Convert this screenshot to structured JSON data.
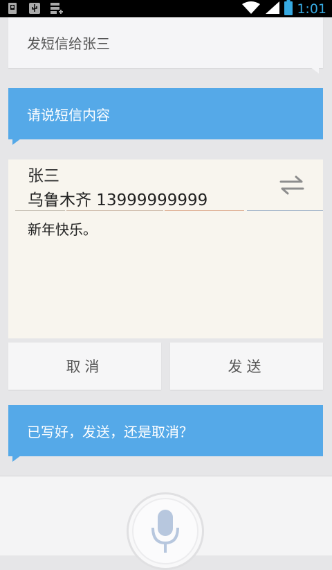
{
  "status_bar": {
    "time": "1:01",
    "icons": [
      "debug-icon",
      "usb-icon",
      "storage-icon",
      "wifi-icon",
      "signal-icon",
      "battery-icon"
    ],
    "time_color": "#36a9e1"
  },
  "conversation": {
    "user_command": "发短信给张三",
    "prompt_content": "请说短信内容",
    "prompt_confirm": "已写好，发送，还是取消？"
  },
  "composer": {
    "recipient_name": "张三",
    "recipient_number": "乌鲁木齐 13999999999",
    "message_body": "新年快乐。",
    "swap_icon": "swap-arrows-icon"
  },
  "actions": {
    "cancel_label": "取消",
    "send_label": "发送"
  },
  "voice": {
    "mic_icon": "microphone-icon"
  },
  "colors": {
    "accent_blue": "#55a9e8",
    "background": "#e6e6e8",
    "composer_bg": "#f8f5ee"
  }
}
